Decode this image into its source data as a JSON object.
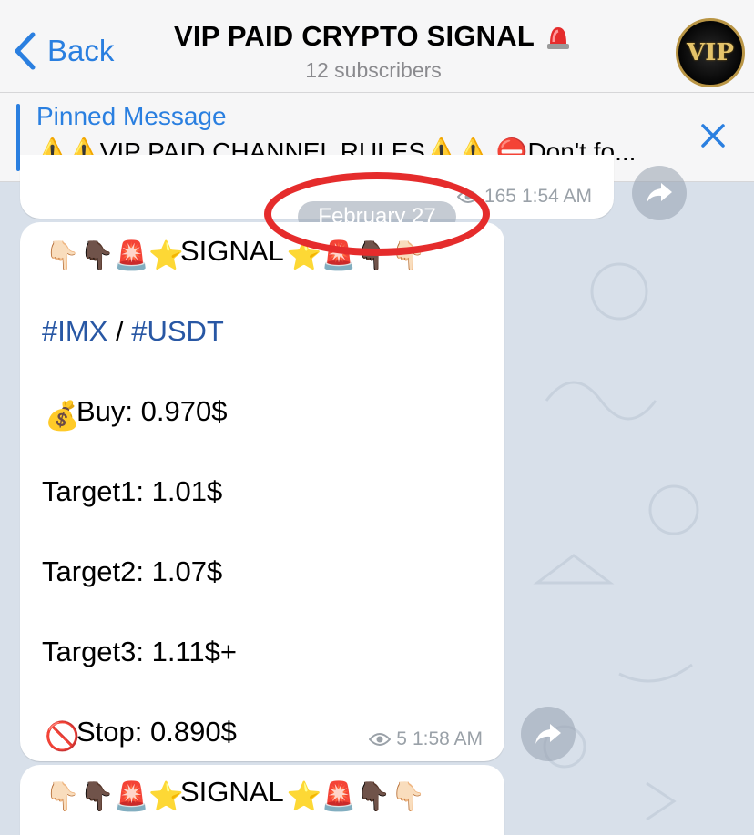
{
  "header": {
    "back_label": "Back",
    "title": "VIP PAID CRYPTO SIGNAL",
    "subtitle": "12 subscribers",
    "avatar_text": "VIP"
  },
  "pinned": {
    "title": "Pinned Message",
    "text": "⚠️⚠️VIP PAID CHANNEL RULES⚠️⚠️ ⛔Don't fo..."
  },
  "previous_message": {
    "views": "165",
    "time": "1:54 AM"
  },
  "date_separator": "February 27",
  "message": {
    "signal_text": "SIGNAL",
    "pair_base": "#IMX",
    "pair_sep": " / ",
    "pair_quote": "#USDT",
    "buy": "Buy: 0.970$",
    "target1": "Target1: 1.01$",
    "target2": "Target2: 1.07$",
    "target3": "Target3: 1.11$+",
    "stop": "Stop: 0.890$",
    "views": "5",
    "time": "1:58 AM"
  },
  "next_message": {
    "signal_text": "SIGNAL"
  },
  "colors": {
    "accent": "#2a7fe0",
    "hashtag": "#2857a4",
    "annotation": "#e52c2c",
    "chat_bg": "#d8e0ea"
  }
}
